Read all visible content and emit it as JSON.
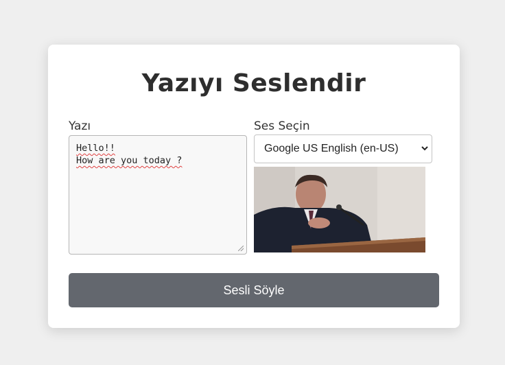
{
  "page": {
    "title": "Yazıyı Seslendir"
  },
  "form": {
    "text_label": "Yazı",
    "text_value": "Hello!!\nHow are you today ?",
    "voice_label": "Ses Seçin",
    "voice_selected": "Google US English (en-US)",
    "speak_button": "Sesli Söyle"
  },
  "icons": {
    "select_arrow": "chevron-down-icon",
    "resize": "resize-grip-icon"
  },
  "colors": {
    "background": "#efefef",
    "card": "#ffffff",
    "button": "#63676e"
  }
}
